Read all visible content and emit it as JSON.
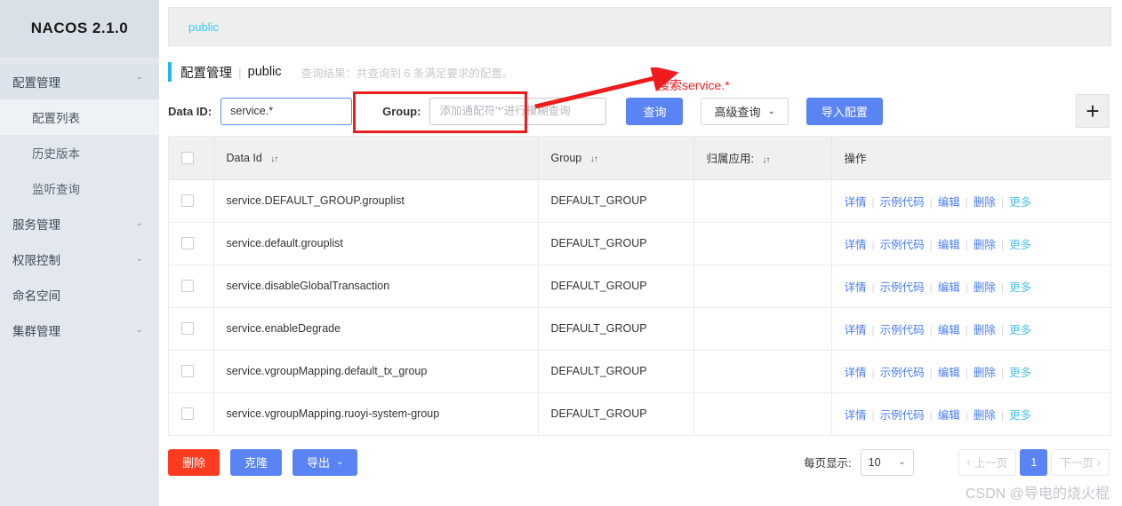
{
  "sidebar": {
    "brand": "NACOS 2.1.0",
    "groups": [
      {
        "label": "配置管理",
        "chevron": "⌃",
        "children": [
          {
            "label": "配置列表"
          },
          {
            "label": "历史版本"
          },
          {
            "label": "监听查询"
          }
        ]
      },
      {
        "label": "服务管理",
        "chevron": "⌄"
      },
      {
        "label": "权限控制",
        "chevron": "⌄"
      },
      {
        "label": "命名空间",
        "chevron": ""
      },
      {
        "label": "集群管理",
        "chevron": "⌄"
      }
    ]
  },
  "tabbar": {
    "public_tab": "public"
  },
  "header": {
    "title": "配置管理",
    "separator": "|",
    "namespace": "public",
    "result_note": "查询结果：共查询到 6 条满足要求的配置。"
  },
  "search": {
    "dataid_label": "Data ID:",
    "dataid_value": "service.*",
    "dataid_placeholder": "",
    "group_label": "Group:",
    "group_value": "",
    "group_placeholder": "添加通配符'*'进行模糊查询",
    "query_button": "查询",
    "advanced_button": "高级查询",
    "advanced_chevron": "⌄",
    "import_button": "导入配置",
    "plus_button": "+"
  },
  "annotation": {
    "text": "搜索service.*",
    "color": "#ee1c1c"
  },
  "table": {
    "columns": [
      {
        "label": "",
        "sort": ""
      },
      {
        "label": "Data Id",
        "sort": "↓↑"
      },
      {
        "label": "Group",
        "sort": "↓↑"
      },
      {
        "label": "归属应用:",
        "sort": "↓↑"
      },
      {
        "label": "操作",
        "sort": ""
      }
    ],
    "action_labels": [
      "详情",
      "示例代码",
      "编辑",
      "删除",
      "更多"
    ],
    "action_separator": "|",
    "rows": [
      {
        "data_id": "service.DEFAULT_GROUP.grouplist",
        "group": "DEFAULT_GROUP",
        "app": ""
      },
      {
        "data_id": "service.default.grouplist",
        "group": "DEFAULT_GROUP",
        "app": ""
      },
      {
        "data_id": "service.disableGlobalTransaction",
        "group": "DEFAULT_GROUP",
        "app": ""
      },
      {
        "data_id": "service.enableDegrade",
        "group": "DEFAULT_GROUP",
        "app": ""
      },
      {
        "data_id": "service.vgroupMapping.default_tx_group",
        "group": "DEFAULT_GROUP",
        "app": ""
      },
      {
        "data_id": "service.vgroupMapping.ruoyi-system-group",
        "group": "DEFAULT_GROUP",
        "app": ""
      }
    ]
  },
  "footer": {
    "delete_button": "删除",
    "clone_button": "克隆",
    "export_button": "导出",
    "export_chevron": "⌄",
    "per_page_label": "每页显示:",
    "per_page_value": "10",
    "per_page_chevron": "⌄",
    "prev_page": "上一页",
    "prev_arrow": "‹",
    "current_page": "1",
    "next_page": "下一页",
    "next_arrow": "›"
  },
  "watermark": {
    "text": "CSDN @导电的烧火棍"
  }
}
